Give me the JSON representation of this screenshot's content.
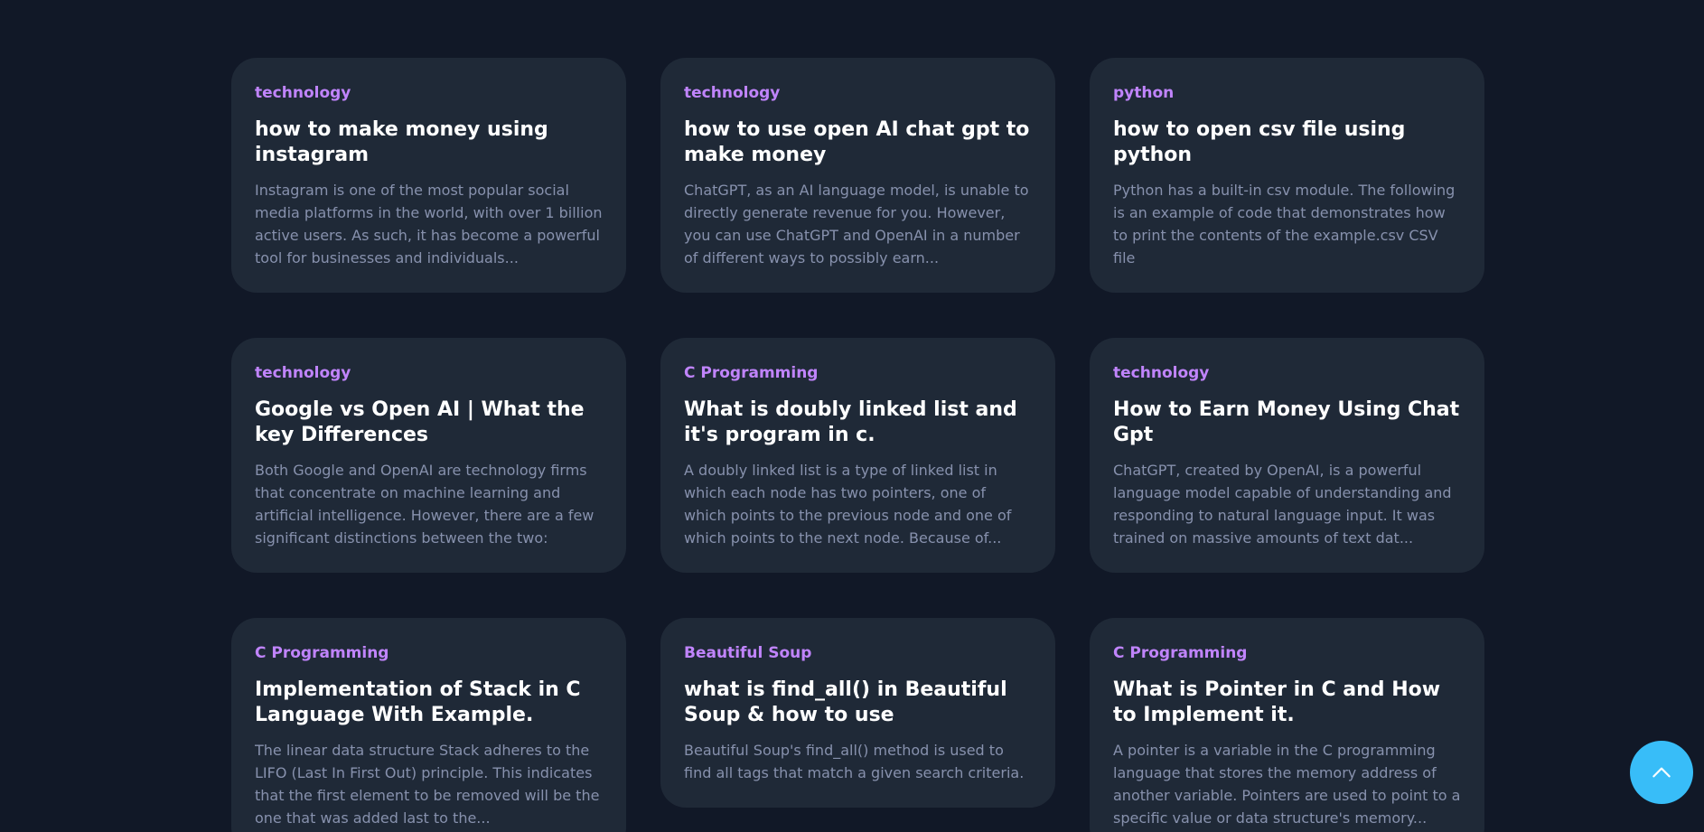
{
  "colors": {
    "background": "#111827",
    "card": "#1f2937",
    "category": "#c084fc",
    "title": "#ffffff",
    "excerpt": "#8791ad",
    "scroll_button": "#38bdf8"
  },
  "posts": [
    {
      "category": "technology",
      "title": "how to make money using instagram",
      "excerpt": "Instagram is one of the most popular social media platforms in the world, with over 1 billion active users. As such, it has become a powerful tool for businesses and individuals..."
    },
    {
      "category": "technology",
      "title": "how to use open AI chat gpt to make money",
      "excerpt": "ChatGPT, as an AI language model, is unable to directly generate revenue for you. However, you can use ChatGPT and OpenAI in a number of different ways to possibly earn..."
    },
    {
      "category": "python",
      "title": "how to open csv file using python",
      "excerpt": "Python has a built-in csv module. The following is an example of code that demonstrates how to print the contents of the example.csv CSV file"
    },
    {
      "category": "technology",
      "title": "Google vs Open AI | What the key Differences",
      "excerpt": "Both Google and OpenAI are technology firms that concentrate on machine learning and artificial intelligence. However, there are a few significant distinctions between the two:"
    },
    {
      "category": "C Programming",
      "title": "What is doubly linked list and it's program in c.",
      "excerpt": "A doubly linked list is a type of linked list in which each node has two pointers, one of which points to the previous node and one of which points to the next node. Because of..."
    },
    {
      "category": "technology",
      "title": "How to Earn Money Using Chat Gpt",
      "excerpt": "ChatGPT, created by OpenAI, is a powerful language model capable of understanding and responding to natural language input. It was trained on massive amounts of text dat..."
    },
    {
      "category": "C Programming",
      "title": "Implementation of Stack in C Language With Example.",
      "excerpt": "The linear data structure Stack adheres to the LIFO (Last In First Out) principle. This indicates that the first element to be removed will be the one that was added last to the..."
    },
    {
      "category": "Beautiful Soup",
      "title": "what is find_all() in Beautiful Soup & how to use",
      "excerpt": "Beautiful Soup's find_all() method is used to find all tags that match a given search criteria."
    },
    {
      "category": "C Programming",
      "title": "What is Pointer in C and How to Implement it.",
      "excerpt": "A pointer is a variable in the C programming language that stores the memory address of another variable. Pointers are used to point to a specific value or data structure's memory..."
    }
  ],
  "scroll_top": {
    "icon": "chevron-up-icon"
  }
}
